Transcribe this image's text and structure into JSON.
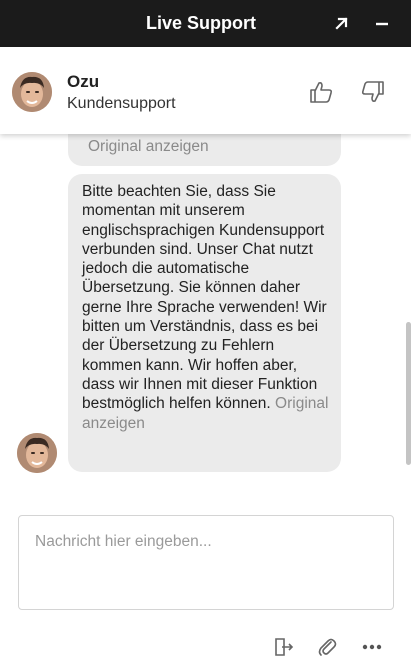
{
  "window": {
    "title": "Live Support",
    "expand_icon": "arrow-up-right-icon",
    "minimize_icon": "minimize-icon"
  },
  "agent": {
    "name": "Ozu",
    "role": "Kundensupport",
    "avatar": "agent-avatar-photo",
    "rate_up_icon": "thumbs-up-icon",
    "rate_down_icon": "thumbs-down-icon"
  },
  "messages": [
    {
      "from": "agent",
      "text_visible_fragment": "",
      "show_original_label": "Original anzeigen"
    },
    {
      "from": "agent",
      "text": "Bitte beachten Sie, dass Sie momentan mit unserem englischsprachigen Kundensupport verbunden sind. Unser Chat nutzt jedoch die automatische Übersetzung. Sie können daher gerne Ihre Sprache verwenden! Wir bitten um Verständnis, dass es bei der Übersetzung zu Fehlern kommen kann. Wir hoffen aber, dass wir Ihnen mit dieser Funktion bestmöglich helfen können.",
      "show_original_label": "Original anzeigen"
    }
  ],
  "composer": {
    "placeholder": "Nachricht hier eingeben...",
    "value": ""
  },
  "footer": {
    "icons": [
      "transfer-exit-icon",
      "paperclip-icon",
      "more-dots-icon"
    ]
  },
  "colors": {
    "titlebar": "#1b1b1b",
    "bubble": "#ebebeb",
    "link_gray": "#8a8a8a"
  }
}
